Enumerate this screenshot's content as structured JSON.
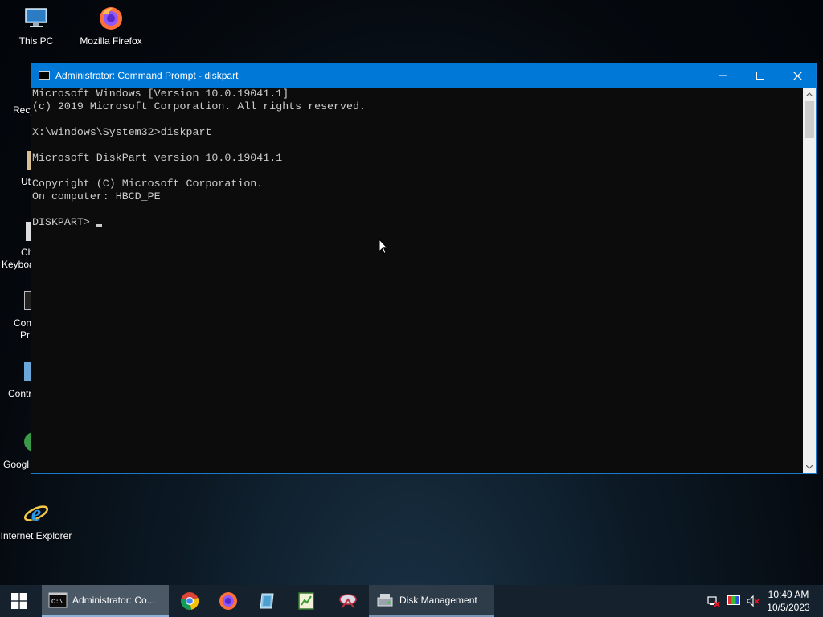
{
  "desktop": {
    "icons": [
      {
        "label": "This PC",
        "icon": "this-pc-icon"
      },
      {
        "label": "Mozilla Firefox",
        "icon": "firefox-icon"
      },
      {
        "label": "Internet Explorer",
        "icon": "internet-explorer-icon"
      }
    ],
    "partial_labels": [
      "Recy",
      "Ut",
      "Ch",
      "Keyboa",
      "Con",
      "Pr",
      "Contr",
      "Googl"
    ]
  },
  "window": {
    "title": "Administrator: Command Prompt - diskpart",
    "icon": "cmd-icon",
    "controls": {
      "minimize": "minimize-icon",
      "maximize": "maximize-icon",
      "close": "close-icon"
    }
  },
  "console": {
    "lines": [
      "Microsoft Windows [Version 10.0.19041.1]",
      "(c) 2019 Microsoft Corporation. All rights reserved.",
      "",
      "X:\\windows\\System32>diskpart",
      "",
      "Microsoft DiskPart version 10.0.19041.1",
      "",
      "Copyright (C) Microsoft Corporation.",
      "On computer: HBCD_PE",
      "",
      "DISKPART> "
    ]
  },
  "taskbar": {
    "start_icon": "windows-start-icon",
    "active_task": {
      "label": "Administrator: Co...",
      "icon": "cmd-icon"
    },
    "pinned": [
      "chrome-icon",
      "firefox-icon",
      "explorer-icon",
      "notepad-icon",
      "network-tool-icon"
    ],
    "running_task": {
      "label": "Disk Management",
      "icon": "disk-management-icon"
    },
    "tray": [
      "network-disconnected-icon",
      "display-color-icon",
      "volume-muted-icon"
    ],
    "time": "10:49 AM",
    "date": "10/5/2023"
  },
  "colors": {
    "titlebar": "#0078d7",
    "console_bg": "#0c0c0c",
    "console_text": "#cccccc",
    "taskbar": "#15222e"
  }
}
